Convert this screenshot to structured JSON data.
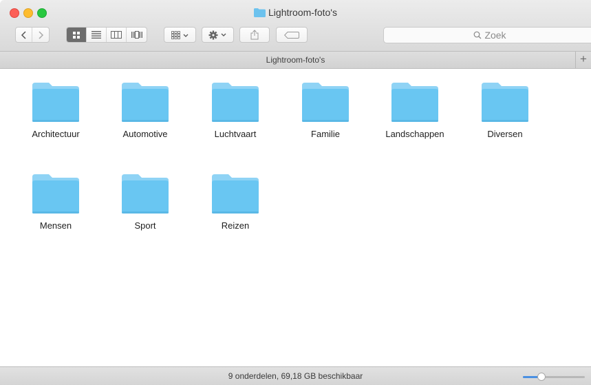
{
  "window": {
    "title": "Lightroom-foto's"
  },
  "toolbar": {
    "back_icon": "chevron-left-icon",
    "forward_icon": "chevron-right-icon",
    "view_modes": [
      "icon-view",
      "list-view",
      "column-view",
      "cover-flow-view"
    ],
    "active_view": "icon-view",
    "arrange_icon": "arrange-icon",
    "action_icon": "gear-icon",
    "share_icon": "share-icon",
    "tag_icon": "tag-icon",
    "search_placeholder": "Zoek"
  },
  "pathbar": {
    "label": "Lightroom-foto's",
    "add_label": "+"
  },
  "items": [
    {
      "name": "Architectuur"
    },
    {
      "name": "Automotive"
    },
    {
      "name": "Luchtvaart"
    },
    {
      "name": "Familie"
    },
    {
      "name": "Landschappen"
    },
    {
      "name": "Diversen"
    },
    {
      "name": "Mensen"
    },
    {
      "name": "Sport"
    },
    {
      "name": "Reizen"
    }
  ],
  "statusbar": {
    "text": "9 onderdelen, 69,18 GB beschikbaar",
    "zoom_level": 0.3
  },
  "colors": {
    "folder": "#69c6f2",
    "folder_tab": "#8fd3f5",
    "accent": "#4a90e2"
  }
}
